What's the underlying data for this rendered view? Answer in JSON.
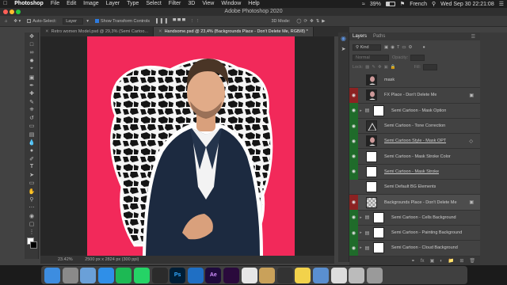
{
  "menubar": {
    "app_name": "Photoshop",
    "items": [
      "File",
      "Edit",
      "Image",
      "Layer",
      "Type",
      "Select",
      "Filter",
      "3D",
      "View",
      "Window",
      "Help"
    ],
    "battery": "39%",
    "language": "French",
    "datetime": "Wed Sep 30  22:21:08"
  },
  "window": {
    "title": "Adobe Photoshop 2020"
  },
  "options": {
    "auto_select_label": "Auto-Select:",
    "auto_select_value": "Layer",
    "transform_label": "Show Transform Controls",
    "mode_label": "3D Mode:"
  },
  "doc_tabs": [
    {
      "label": "Retro women Model.psd @ 29,3% (Semi Cartoo...",
      "active": false
    },
    {
      "label": "Handsome.psd @ 23,4% (Backgrounds Place - Don't Delete Me, RGB/8) *",
      "active": true
    }
  ],
  "status": {
    "zoom": "23.42%",
    "dims": "2500 px x 2824 px (300 ppi)"
  },
  "panel": {
    "tabs": [
      "Layers",
      "Paths"
    ],
    "kind_label": "Kind",
    "blend_mode": "Normal",
    "opacity_label": "Opacity:",
    "lock_label": "Lock:",
    "fill_label": "Fill:"
  },
  "layers": [
    {
      "name": "mask",
      "eye": "none",
      "thumb": "photo",
      "group": false,
      "fx": false,
      "lock": false,
      "underline": false,
      "selected": false
    },
    {
      "name": "FX Place - Don't Delete Me",
      "eye": "red",
      "thumb": "photo",
      "group": false,
      "fx": false,
      "lock": true,
      "underline": false,
      "selected": false
    },
    {
      "name": "Semi Cartoon - Mask Option",
      "eye": "green",
      "thumb": "folder",
      "group": true,
      "fx": false,
      "lock": false,
      "underline": false,
      "selected": false
    },
    {
      "name": "Semi Cartoon - Tone Correction",
      "eye": "green",
      "thumb": "adjust",
      "group": false,
      "fx": false,
      "lock": false,
      "underline": false,
      "selected": false
    },
    {
      "name": "Semi Cartoon Style - Mask OPT",
      "eye": "green",
      "thumb": "photo",
      "group": false,
      "fx": true,
      "lock": false,
      "underline": true,
      "selected": false
    },
    {
      "name": "Semi Cartoon - Mask Stroke Color",
      "eye": "green",
      "thumb": "white",
      "group": false,
      "fx": false,
      "lock": false,
      "underline": false,
      "selected": false
    },
    {
      "name": "Semi Cartoon - Mask Stroke",
      "eye": "green",
      "thumb": "white",
      "group": false,
      "fx": false,
      "lock": false,
      "underline": true,
      "selected": false
    },
    {
      "name": "Semi Default BG Elements",
      "eye": "none",
      "thumb": "white",
      "group": false,
      "fx": false,
      "lock": false,
      "underline": false,
      "selected": false
    },
    {
      "name": "Backgrounds Place - Don't Delete Me",
      "eye": "red",
      "thumb": "checker",
      "group": false,
      "fx": false,
      "lock": true,
      "underline": false,
      "selected": true
    },
    {
      "name": "Semi Cartoon - Cells Background",
      "eye": "green",
      "thumb": "folder",
      "group": true,
      "fx": false,
      "lock": false,
      "underline": false,
      "selected": false
    },
    {
      "name": "Semi Cartoon - Painting Background",
      "eye": "green",
      "thumb": "folder",
      "group": true,
      "fx": false,
      "lock": false,
      "underline": false,
      "selected": false
    },
    {
      "name": "Semi Cartoon - Cloud Background",
      "eye": "green",
      "thumb": "folder",
      "group": true,
      "fx": false,
      "lock": false,
      "underline": false,
      "selected": false
    }
  ],
  "colors": {
    "canvas_bg": "#f2295a",
    "visible_green": "#1f6b2a",
    "locked_red": "#8c2222"
  },
  "dock_apps": [
    {
      "name": "finder",
      "bg": "#3d8de0",
      "label": ""
    },
    {
      "name": "system-preferences",
      "bg": "#8a8a8a",
      "label": ""
    },
    {
      "name": "preview",
      "bg": "#6aa0d8",
      "label": ""
    },
    {
      "name": "safari",
      "bg": "#2f8fe8",
      "label": ""
    },
    {
      "name": "spotify",
      "bg": "#1db954",
      "label": ""
    },
    {
      "name": "whatsapp",
      "bg": "#25d366",
      "label": ""
    },
    {
      "name": "tool-app",
      "bg": "#2b2b2b",
      "label": ""
    },
    {
      "name": "photoshop",
      "bg": "#001e36",
      "label": "Ps"
    },
    {
      "name": "vscode",
      "bg": "#1f6fc4",
      "label": ""
    },
    {
      "name": "after-effects",
      "bg": "#1f0a3c",
      "label": "Ae"
    },
    {
      "name": "premiere",
      "bg": "#2a0a3c",
      "label": ""
    },
    {
      "name": "chrome",
      "bg": "#e6e6e6",
      "label": ""
    },
    {
      "name": "files",
      "bg": "#c9a15a",
      "label": ""
    },
    {
      "name": "media-encoder",
      "bg": "#333",
      "label": ""
    },
    {
      "name": "notes",
      "bg": "#f2d24b",
      "label": ""
    },
    {
      "name": "finder-window",
      "bg": "#5a8fd0",
      "label": ""
    },
    {
      "name": "text-doc",
      "bg": "#dddddd",
      "label": ""
    },
    {
      "name": "screenshot",
      "bg": "#bbbbbb",
      "label": ""
    },
    {
      "name": "trash",
      "bg": "#9a9a9a",
      "label": ""
    }
  ]
}
